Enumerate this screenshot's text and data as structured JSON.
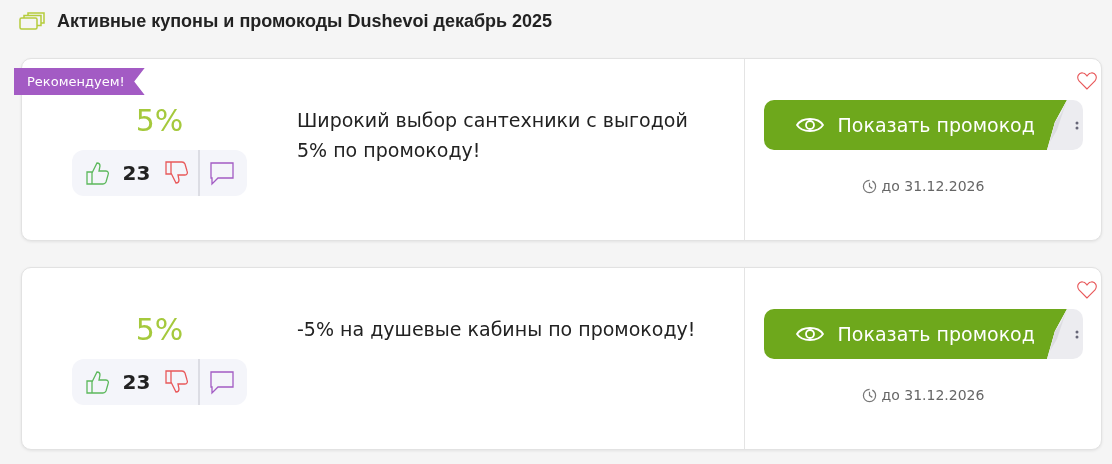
{
  "heading": "Активные купоны и промокоды Dushevoi декабрь 2025",
  "coupons": [
    {
      "badge": "Рекомендуем!",
      "discount": "5%",
      "votes": "23",
      "description": "Широкий выбор сантехники с выгодой 5% по промокоду!",
      "button": "Показать промокод",
      "expiry": "до 31.12.2026"
    },
    {
      "discount": "5%",
      "votes": "23",
      "description": "-5% на душевые кабины по промокоду!",
      "button": "Показать промокод",
      "expiry": "до 31.12.2026"
    }
  ]
}
